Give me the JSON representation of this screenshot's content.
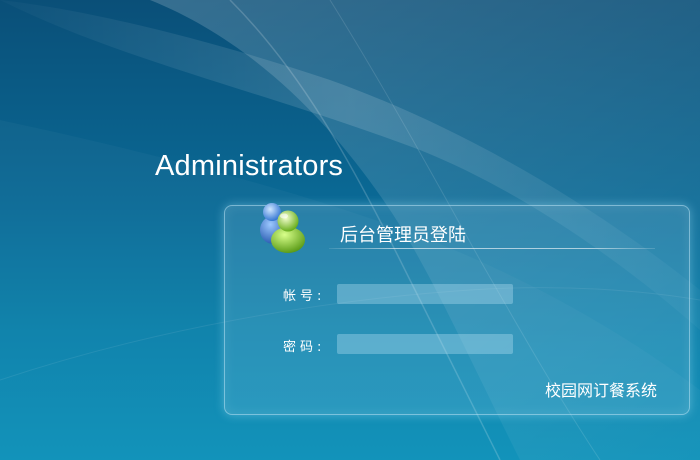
{
  "page": {
    "title": "Administrators"
  },
  "login_panel": {
    "heading": "后台管理员登陆",
    "account": {
      "label": "帐号:",
      "value": "",
      "placeholder": ""
    },
    "password": {
      "label": "密码:",
      "value": "",
      "placeholder": ""
    },
    "footer": "校园网订餐系统"
  },
  "icons": {
    "users": "users-icon"
  },
  "colors": {
    "background_top": "#0a4f78",
    "background_bottom": "#0b90b8",
    "text": "#ffffff"
  }
}
